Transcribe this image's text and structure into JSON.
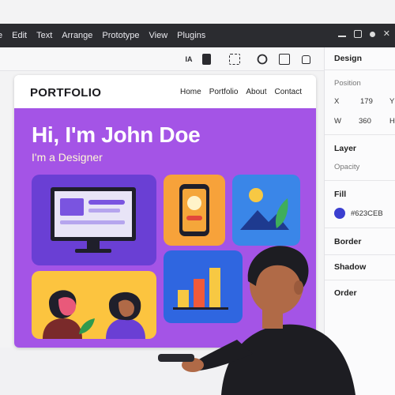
{
  "menubar": {
    "items": [
      "e",
      "Edit",
      "Text",
      "Arrange",
      "Prototype",
      "View",
      "Plugins"
    ]
  },
  "toolbar": {
    "text_tool": "IA"
  },
  "site": {
    "brand": "PORTFOLIO",
    "nav": [
      "Home",
      "Portfolio",
      "About",
      "Contact"
    ],
    "hero_title": "Hi, I'm John Doe",
    "hero_subtitle": "I'm a Designer"
  },
  "design_panel": {
    "title": "Design",
    "position_label": "Position",
    "x_label": "X",
    "x_value": "179",
    "y_label": "Y",
    "w_label": "W",
    "w_value": "360",
    "h_label": "H",
    "layer_label": "Layer",
    "opacity_label": "Opacity",
    "fill_label": "Fill",
    "fill_value": "#623CEB",
    "border_label": "Border",
    "shadow_label": "Shadow",
    "order_label": "Order"
  },
  "colors": {
    "hero_bg": "#a454e6",
    "fill_swatch": "#3b3fd0",
    "menubar_bg": "#2b2c30"
  }
}
